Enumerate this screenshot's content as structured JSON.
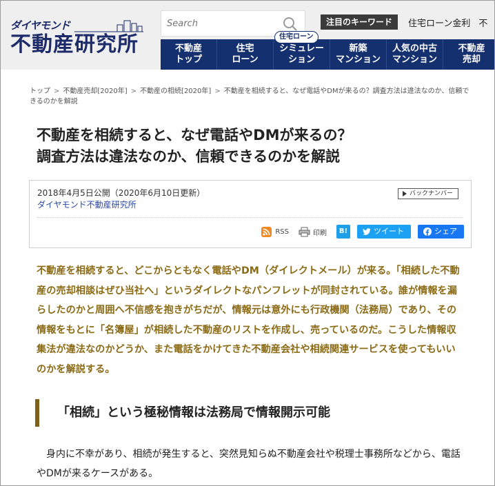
{
  "header": {
    "logo_small": "ダイヤモンド",
    "logo_main": "不動産研究所",
    "search_placeholder": "Search",
    "keyword_label": "注目のキーワード",
    "keywords": [
      "住宅ローン金利",
      "不"
    ],
    "nav_badge": "住宅ローン",
    "nav": [
      "不動産\nトップ",
      "住宅\nローン",
      "シミュレー\nション",
      "新築\nマンション",
      "人気の中古\nマンション",
      "不動産\n売却"
    ]
  },
  "breadcrumb": {
    "items": [
      "トップ",
      "不動産売却[2020年]",
      "不動産の相続[2020年]",
      "不動産を相続すると、なぜ電話やDMが来るの？調査方法は違法なのか、信頼できるのかを解説"
    ],
    "separator": ">"
  },
  "article": {
    "title": "不動産を相続すると、なぜ電話やDMが来るの？\n調査方法は違法なのか、信頼できるのかを解説",
    "date": "2018年4月5日公開（2020年6月10日更新）",
    "author": "ダイヤモンド不動産研究所",
    "backnumber_label": "バックナンバー",
    "share": {
      "rss": "RSS",
      "print": "印刷",
      "hatena": "B!",
      "tweet": "ツイート",
      "facebook": "シェア"
    },
    "lead": "不動産を相続すると、どこからともなく電話やDM（ダイレクトメール）が来る。「相続した不動産の売却相談はぜひ当社へ」というダイレクトなパンフレットが同封されている。誰が情報を漏らしたのかと周囲へ不信感を抱きがちだが、情報元は意外にも行政機関（法務局）であり、その情報をもとに「名簿屋」が相続した不動産のリストを作成し、売っているのだ。こうした情報収集法が違法なのかどうか、また電話をかけてきた不動産会社や相続関連サービスを使ってもいいのかを解説する。",
    "section_heading": "「相続」という極秘情報は法務局で情報開示可能",
    "body": "身内に不幸があり、相続が発生すると、突然見知らぬ不動産会社や税理士事務所などから、電話やDMが来るケースがある。"
  },
  "colors": {
    "nav_bg": "#15306f",
    "lead_text": "#8b6b16",
    "heading_bar": "#7d6118"
  }
}
